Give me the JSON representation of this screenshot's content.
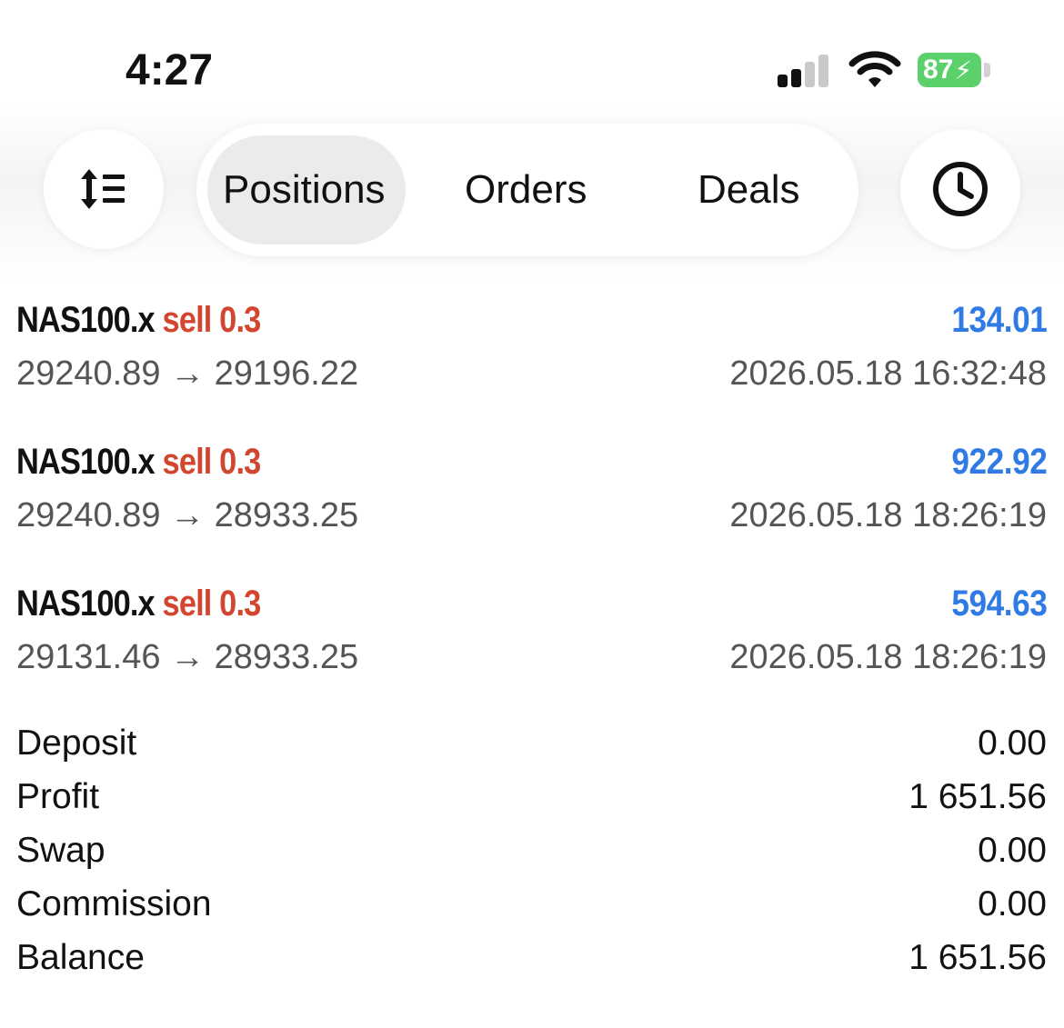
{
  "status_bar": {
    "time": "4:27",
    "battery": "87",
    "battery_color": "#5cd16b"
  },
  "toolbar": {
    "sort_icon": "sort-lines-icon",
    "history_icon": "clock-icon",
    "tabs": [
      {
        "label": "Positions",
        "active": true
      },
      {
        "label": "Orders",
        "active": false
      },
      {
        "label": "Deals",
        "active": false
      }
    ]
  },
  "trades": [
    {
      "symbol": "NAS100.x",
      "side": "sell 0.3",
      "profit": "134.01",
      "prices": "29240.89 → 29196.22",
      "time": "2026.05.18 16:32:48"
    },
    {
      "symbol": "NAS100.x",
      "side": "sell 0.3",
      "profit": "922.92",
      "prices": "29240.89 → 28933.25",
      "time": "2026.05.18 18:26:19"
    },
    {
      "symbol": "NAS100.x",
      "side": "sell 0.3",
      "profit": "594.63",
      "prices": "29131.46 → 28933.25",
      "time": "2026.05.18 18:26:19"
    }
  ],
  "summary": [
    {
      "label": "Deposit",
      "value": "0.00"
    },
    {
      "label": "Profit",
      "value": "1 651.56"
    },
    {
      "label": "Swap",
      "value": "0.00"
    },
    {
      "label": "Commission",
      "value": "0.00"
    },
    {
      "label": "Balance",
      "value": "1 651.56"
    }
  ],
  "colors": {
    "sell": "#d2452f",
    "profit": "#2f7ae5"
  }
}
